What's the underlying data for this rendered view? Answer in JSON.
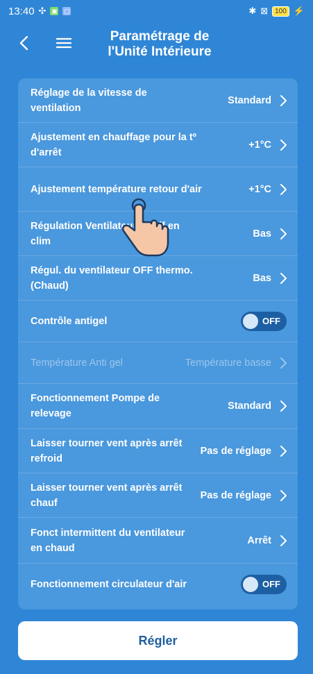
{
  "status_bar": {
    "time": "13:40",
    "battery": "100"
  },
  "header": {
    "title_line1": "Paramétrage de",
    "title_line2": "l'Unité Intérieure"
  },
  "settings": [
    {
      "label": "Réglage de la vitesse de ventilation",
      "value": "Standard",
      "type": "select"
    },
    {
      "label": "Ajustement en chauffage pour la tº d'arrêt",
      "value": "+1°C",
      "type": "select"
    },
    {
      "label": "Ajustement température retour d'air",
      "value": "+1°C",
      "type": "select"
    },
    {
      "label": "Régulation Ventilateur Tº off en clim",
      "value": "Bas",
      "type": "select"
    },
    {
      "label": "Régul. du ventilateur OFF thermo. (Chaud)",
      "value": "Bas",
      "type": "select"
    },
    {
      "label": "Contrôle antigel",
      "value": "OFF",
      "type": "toggle"
    },
    {
      "label": "Température Anti gel",
      "value": "Température basse",
      "type": "select",
      "disabled": true
    },
    {
      "label": "Fonctionnement Pompe de relevage",
      "value": "Standard",
      "type": "select"
    },
    {
      "label": "Laisser tourner vent après arrêt refroid",
      "value": "Pas de réglage",
      "type": "select"
    },
    {
      "label": "Laisser tourner vent après arrêt chauf",
      "value": "Pas de réglage",
      "type": "select"
    },
    {
      "label": "Fonct intermittent du ventilateur en chaud",
      "value": "Arrêt",
      "type": "select"
    },
    {
      "label": "Fonctionnement circulateur d'air",
      "value": "OFF",
      "type": "toggle"
    }
  ],
  "apply_button": {
    "label": "Régler"
  },
  "colors": {
    "background": "#2f86d6",
    "card": "#4a98dd",
    "toggle_off": "#1d5fa3",
    "button_text": "#1f5f9e"
  }
}
